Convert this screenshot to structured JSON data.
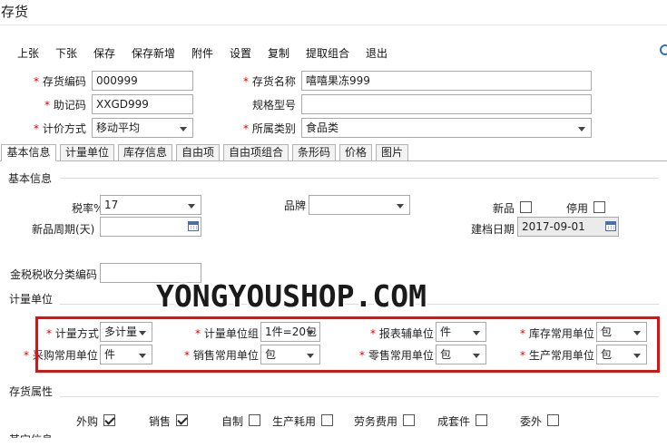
{
  "window": {
    "title": "存货"
  },
  "toolbar": {
    "items": [
      "上张",
      "下张",
      "保存",
      "保存新增",
      "附件",
      "设置",
      "复制",
      "提取组合",
      "退出"
    ]
  },
  "header_form": {
    "code_label": "存货编码",
    "code_value": "000999",
    "name_label": "存货名称",
    "name_value": "嘻嘻果冻999",
    "mnemonic_label": "助记码",
    "mnemonic_value": "XXGD999",
    "spec_label": "规格型号",
    "spec_value": "",
    "pricing_label": "计价方式",
    "pricing_value": "移动平均",
    "category_label": "所属类别",
    "category_value": "食品类"
  },
  "tabs": [
    "基本信息",
    "计量单位",
    "库存信息",
    "自由项",
    "自由项组合",
    "条形码",
    "价格",
    "图片"
  ],
  "basic": {
    "section_title": "基本信息",
    "tax_label": "税率%",
    "tax_value": "17",
    "brand_label": "品牌",
    "brand_value": "",
    "new_label": "新品",
    "disabled_label": "停用",
    "new_period_label": "新品周期(天)",
    "new_period_value": "",
    "created_date_label": "建档日期",
    "created_date_value": "2017-09-01",
    "tax_code_label": "金税税收分类编码",
    "tax_code_value": ""
  },
  "units": {
    "section_title": "计量单位",
    "method_label": "计量方式",
    "method_value": "多计量",
    "group_label": "计量单位组",
    "group_value": "1件=20包",
    "report_label": "报表辅单位",
    "report_value": "件",
    "stock_label": "库存常用单位",
    "stock_value": "包",
    "purchase_label": "采购常用单位",
    "purchase_value": "件",
    "sales_label": "销售常用单位",
    "sales_value": "包",
    "retail_label": "零售常用单位",
    "retail_value": "包",
    "production_label": "生产常用单位",
    "production_value": "包"
  },
  "attributes": {
    "section_title": "存货属性",
    "items": [
      {
        "label": "外购",
        "checked": true
      },
      {
        "label": "销售",
        "checked": true
      },
      {
        "label": "自制",
        "checked": false
      },
      {
        "label": "生产耗用",
        "checked": false
      },
      {
        "label": "劳务费用",
        "checked": false
      },
      {
        "label": "成套件",
        "checked": false
      },
      {
        "label": "委外",
        "checked": false
      }
    ]
  },
  "footer_partial": {
    "section_title": "其它信息"
  },
  "watermark": "YONGYOUSHOP.COM",
  "colors": {
    "required": "#e00000",
    "highlight_box": "#e01010",
    "border": "#a9a9a9"
  }
}
